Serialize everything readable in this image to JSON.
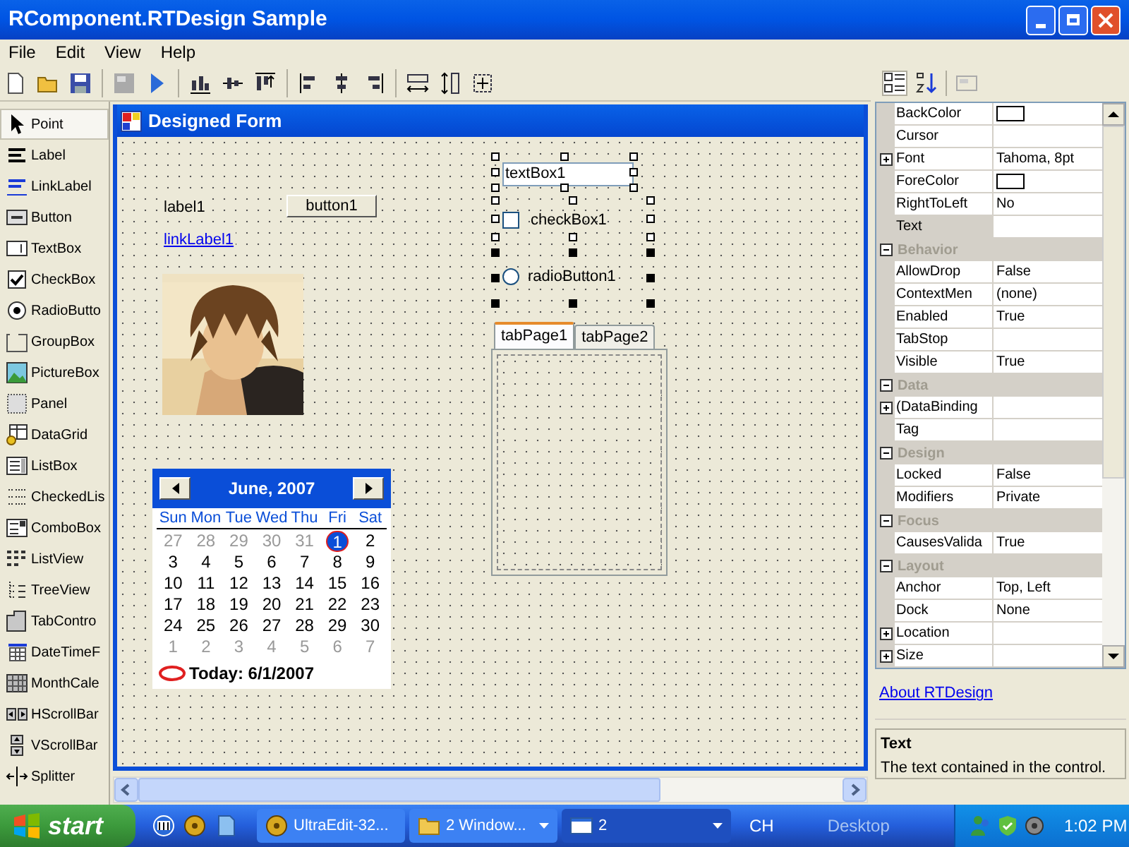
{
  "window": {
    "title": "RComponent.RTDesign Sample"
  },
  "menu": [
    "File",
    "Edit",
    "View",
    "Help"
  ],
  "toolbox": [
    {
      "label": "Point",
      "selected": true
    },
    {
      "label": "Label",
      "selected": false
    },
    {
      "label": "LinkLabel",
      "selected": false
    },
    {
      "label": "Button",
      "selected": false
    },
    {
      "label": "TextBox",
      "selected": false
    },
    {
      "label": "CheckBox",
      "selected": false
    },
    {
      "label": "RadioButto",
      "selected": false
    },
    {
      "label": "GroupBox",
      "selected": false
    },
    {
      "label": "PictureBox",
      "selected": false
    },
    {
      "label": "Panel",
      "selected": false
    },
    {
      "label": "DataGrid",
      "selected": false
    },
    {
      "label": "ListBox",
      "selected": false
    },
    {
      "label": "CheckedLis",
      "selected": false
    },
    {
      "label": "ComboBox",
      "selected": false
    },
    {
      "label": "ListView",
      "selected": false
    },
    {
      "label": "TreeView",
      "selected": false
    },
    {
      "label": "TabContro",
      "selected": false
    },
    {
      "label": "DateTimeF",
      "selected": false
    },
    {
      "label": "MonthCale",
      "selected": false
    },
    {
      "label": "HScrollBar",
      "selected": false
    },
    {
      "label": "VScrollBar",
      "selected": false
    },
    {
      "label": "Splitter",
      "selected": false
    }
  ],
  "designer": {
    "title": "Designed Form",
    "label": "label1",
    "button": "button1",
    "link": "linkLabel1",
    "textbox": {
      "value": "textBox1",
      "selected": true
    },
    "checkbox": {
      "label": "checkBox1",
      "checked": false,
      "selected": true
    },
    "radio": {
      "label": "radioButton1",
      "checked": false,
      "selected": true
    },
    "tabs": [
      {
        "label": "tabPage1",
        "selected": true
      },
      {
        "label": "tabPage2",
        "selected": false
      }
    ],
    "calendar": {
      "month": "June, 2007",
      "weekdays": [
        "Sun",
        "Mon",
        "Tue",
        "Wed",
        "Thu",
        "Fri",
        "Sat"
      ],
      "weeks": [
        [
          {
            "day": "27",
            "other_month": true,
            "selected": false
          },
          {
            "day": "28",
            "other_month": true,
            "selected": false
          },
          {
            "day": "29",
            "other_month": true,
            "selected": false
          },
          {
            "day": "30",
            "other_month": true,
            "selected": false
          },
          {
            "day": "31",
            "other_month": true,
            "selected": false
          },
          {
            "day": "1",
            "other_month": false,
            "selected": true
          },
          {
            "day": "2",
            "other_month": false,
            "selected": false
          }
        ],
        [
          {
            "day": "3",
            "other_month": false,
            "selected": false
          },
          {
            "day": "4",
            "other_month": false,
            "selected": false
          },
          {
            "day": "5",
            "other_month": false,
            "selected": false
          },
          {
            "day": "6",
            "other_month": false,
            "selected": false
          },
          {
            "day": "7",
            "other_month": false,
            "selected": false
          },
          {
            "day": "8",
            "other_month": false,
            "selected": false
          },
          {
            "day": "9",
            "other_month": false,
            "selected": false
          }
        ],
        [
          {
            "day": "10",
            "other_month": false,
            "selected": false
          },
          {
            "day": "11",
            "other_month": false,
            "selected": false
          },
          {
            "day": "12",
            "other_month": false,
            "selected": false
          },
          {
            "day": "13",
            "other_month": false,
            "selected": false
          },
          {
            "day": "14",
            "other_month": false,
            "selected": false
          },
          {
            "day": "15",
            "other_month": false,
            "selected": false
          },
          {
            "day": "16",
            "other_month": false,
            "selected": false
          }
        ],
        [
          {
            "day": "17",
            "other_month": false,
            "selected": false
          },
          {
            "day": "18",
            "other_month": false,
            "selected": false
          },
          {
            "day": "19",
            "other_month": false,
            "selected": false
          },
          {
            "day": "20",
            "other_month": false,
            "selected": false
          },
          {
            "day": "21",
            "other_month": false,
            "selected": false
          },
          {
            "day": "22",
            "other_month": false,
            "selected": false
          },
          {
            "day": "23",
            "other_month": false,
            "selected": false
          }
        ],
        [
          {
            "day": "24",
            "other_month": false,
            "selected": false
          },
          {
            "day": "25",
            "other_month": false,
            "selected": false
          },
          {
            "day": "26",
            "other_month": false,
            "selected": false
          },
          {
            "day": "27",
            "other_month": false,
            "selected": false
          },
          {
            "day": "28",
            "other_month": false,
            "selected": false
          },
          {
            "day": "29",
            "other_month": false,
            "selected": false
          },
          {
            "day": "30",
            "other_month": false,
            "selected": false
          }
        ],
        [
          {
            "day": "1",
            "other_month": true,
            "selected": false
          },
          {
            "day": "2",
            "other_month": true,
            "selected": false
          },
          {
            "day": "3",
            "other_month": true,
            "selected": false
          },
          {
            "day": "4",
            "other_month": true,
            "selected": false
          },
          {
            "day": "5",
            "other_month": true,
            "selected": false
          },
          {
            "day": "6",
            "other_month": true,
            "selected": false
          },
          {
            "day": "7",
            "other_month": true,
            "selected": false
          }
        ]
      ],
      "today": "Today: 6/1/2007"
    }
  },
  "property_grid": {
    "toolbar": [
      {
        "kind": "categorized",
        "selected": true
      },
      {
        "kind": "alphabetical",
        "selected": false
      },
      {
        "kind": "pages",
        "disabled": true
      }
    ],
    "rows": [
      {
        "kind": "property",
        "name": "BackColor",
        "color": "#ffffff",
        "selected": false
      },
      {
        "kind": "property",
        "name": "Cursor",
        "selected": false
      },
      {
        "kind": "property",
        "name": "Font",
        "value": "Tahoma, 8pt",
        "expandable": true,
        "selected": false
      },
      {
        "kind": "property",
        "name": "ForeColor",
        "color": "#ffffff",
        "selected": false
      },
      {
        "kind": "property",
        "name": "RightToLeft",
        "value": "No",
        "selected": false
      },
      {
        "kind": "property",
        "name": "Text",
        "selected": true
      },
      {
        "kind": "category",
        "name": "Behavior",
        "expanded": true
      },
      {
        "kind": "property",
        "name": "AllowDrop",
        "value": "False",
        "selected": false
      },
      {
        "kind": "property",
        "name": "ContextMen",
        "value": "(none)",
        "selected": false
      },
      {
        "kind": "property",
        "name": "Enabled",
        "value": "True",
        "selected": false
      },
      {
        "kind": "property",
        "name": "TabStop",
        "selected": false
      },
      {
        "kind": "property",
        "name": "Visible",
        "value": "True",
        "selected": false
      },
      {
        "kind": "category",
        "name": "Data",
        "expanded": true
      },
      {
        "kind": "property",
        "name": "(DataBinding",
        "expandable": true,
        "selected": false
      },
      {
        "kind": "property",
        "name": "Tag",
        "selected": false
      },
      {
        "kind": "category",
        "name": "Design",
        "expanded": true
      },
      {
        "kind": "property",
        "name": "Locked",
        "value": "False",
        "selected": false
      },
      {
        "kind": "property",
        "name": "Modifiers",
        "value": "Private",
        "selected": false
      },
      {
        "kind": "category",
        "name": "Focus",
        "expanded": true
      },
      {
        "kind": "property",
        "name": "CausesValida",
        "value": "True",
        "selected": false
      },
      {
        "kind": "category",
        "name": "Layout",
        "expanded": true
      },
      {
        "kind": "property",
        "name": "Anchor",
        "value": "Top, Left",
        "selected": false
      },
      {
        "kind": "property",
        "name": "Dock",
        "value": "None",
        "selected": false
      },
      {
        "kind": "property",
        "name": "Location",
        "expandable": true,
        "selected": false
      },
      {
        "kind": "property",
        "name": "Size",
        "expandable": true,
        "selected": false
      }
    ],
    "link": "About RTDesign",
    "help": {
      "title": "Text",
      "description": "The text contained in the control."
    }
  },
  "taskbar": {
    "start": "start",
    "tasks": [
      {
        "kind": "app",
        "label": "UltraEdit-32...",
        "selected": false
      },
      {
        "kind": "folder",
        "label": "2 Window...",
        "selected": false
      },
      {
        "kind": "window",
        "label": "2",
        "selected": true
      }
    ],
    "language": "CH",
    "desktop": "Desktop",
    "clock": "1:02 PM"
  }
}
